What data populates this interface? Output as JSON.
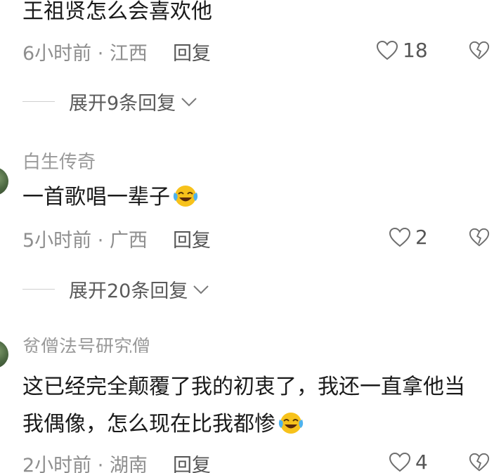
{
  "comments": [
    {
      "username": "",
      "content": "王祖贤怎么会喜欢他",
      "has_emoji": false,
      "time": "6小时前",
      "location": "江西",
      "reply_label": "回复",
      "likes": "18",
      "expand_label": "展开9条回复"
    },
    {
      "username": "白生传奇",
      "content": "一首歌唱一辈子",
      "has_emoji": true,
      "time": "5小时前",
      "location": "广西",
      "reply_label": "回复",
      "likes": "2",
      "expand_label": "展开20条回复"
    },
    {
      "username": "贫僧法号研究僧",
      "content": "这已经完全颠覆了我的初衷了，我还一直拿他当我偶像，怎么现在比我都惨",
      "has_emoji": true,
      "time": "2小时前",
      "location": "湖南",
      "reply_label": "回复",
      "likes": "4",
      "expand_label": ""
    }
  ],
  "separator": " · ",
  "icons": {
    "like": "heart-outline-icon",
    "dislike": "broken-heart-icon",
    "expand": "chevron-down-icon",
    "emoji": "laughing-crying-emoji-icon"
  },
  "colors": {
    "meta_text": "#8e8e8e",
    "username_text": "#9a9a9a",
    "body_text": "#1a1a1a"
  }
}
